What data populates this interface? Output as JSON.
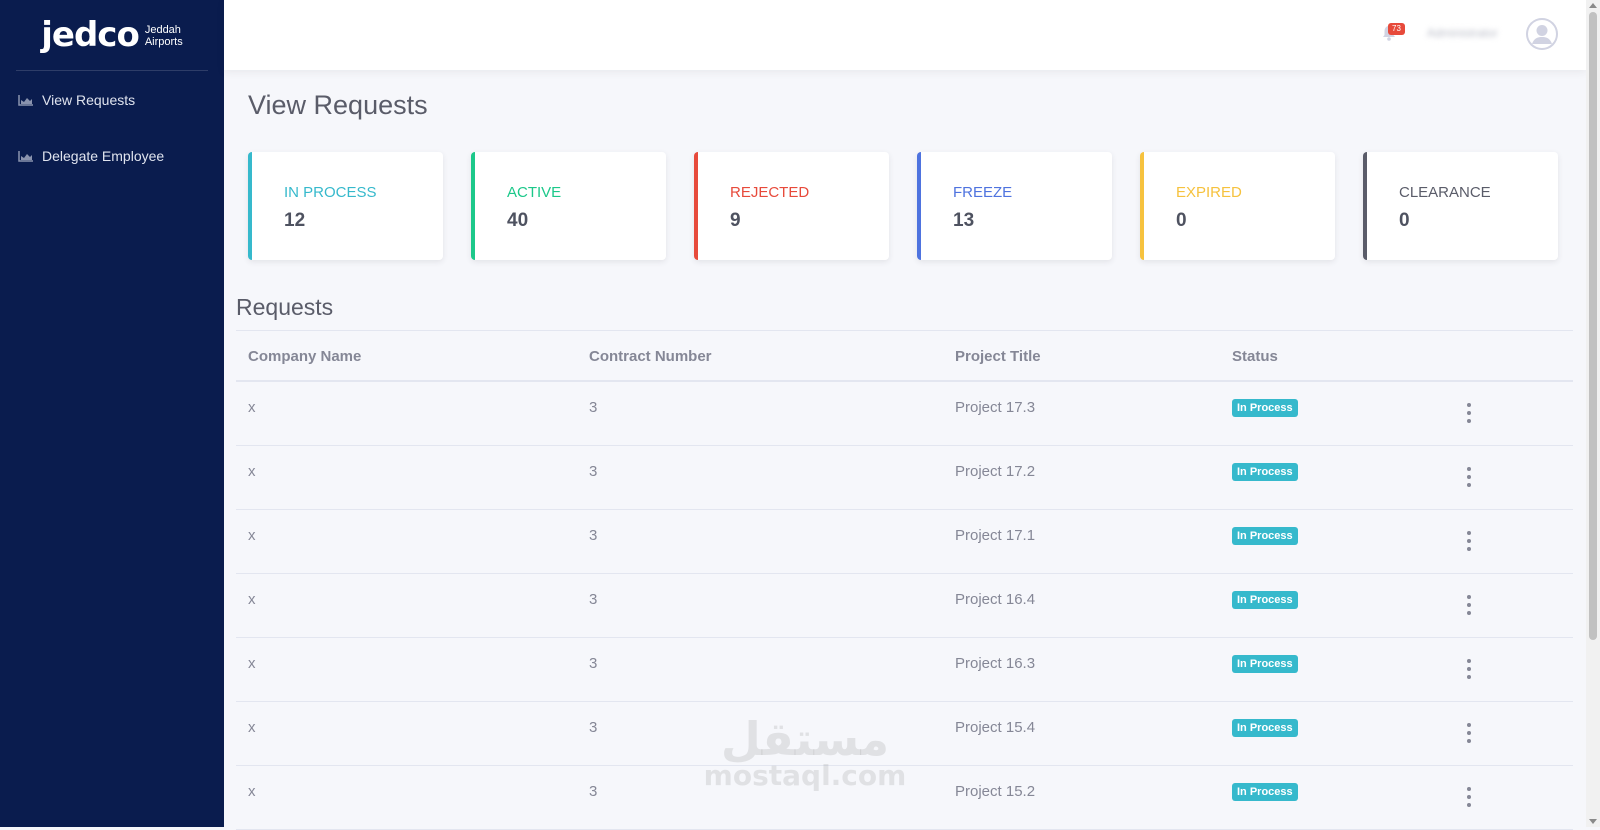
{
  "brand": {
    "main": "jedco",
    "sub_line1": "Jeddah",
    "sub_line2": "Airports"
  },
  "sidebar": {
    "items": [
      {
        "label": "View Requests",
        "icon": "chart-area-icon"
      },
      {
        "label": "Delegate Employee",
        "icon": "chart-area-icon"
      }
    ]
  },
  "topbar": {
    "notification_count": "73",
    "user_name": "Administrator"
  },
  "page_title": "View Requests",
  "cards": [
    {
      "label": "IN PROCESS",
      "value": "12",
      "color": "#36b9cc"
    },
    {
      "label": "ACTIVE",
      "value": "40",
      "color": "#1cc88a"
    },
    {
      "label": "REJECTED",
      "value": "9",
      "color": "#e74a3b"
    },
    {
      "label": "FREEZE",
      "value": "13",
      "color": "#4e73df"
    },
    {
      "label": "EXPIRED",
      "value": "0",
      "color": "#f6c23e"
    },
    {
      "label": "CLEARANCE",
      "value": "0",
      "color": "#5a5c69"
    }
  ],
  "requests": {
    "title": "Requests",
    "headers": [
      "Company Name",
      "Contract Number",
      "Project Title",
      "Status"
    ],
    "rows": [
      {
        "company": "x",
        "contract": "3",
        "title": "Project 17.3",
        "status": "In Process"
      },
      {
        "company": "x",
        "contract": "3",
        "title": "Project 17.2",
        "status": "In Process"
      },
      {
        "company": "x",
        "contract": "3",
        "title": "Project 17.1",
        "status": "In Process"
      },
      {
        "company": "x",
        "contract": "3",
        "title": "Project 16.4",
        "status": "In Process"
      },
      {
        "company": "x",
        "contract": "3",
        "title": "Project 16.3",
        "status": "In Process"
      },
      {
        "company": "x",
        "contract": "3",
        "title": "Project 15.4",
        "status": "In Process"
      },
      {
        "company": "x",
        "contract": "3",
        "title": "Project 15.2",
        "status": "In Process"
      }
    ]
  },
  "watermark": {
    "logo": "مستقل",
    "text": "mostaql.com"
  }
}
